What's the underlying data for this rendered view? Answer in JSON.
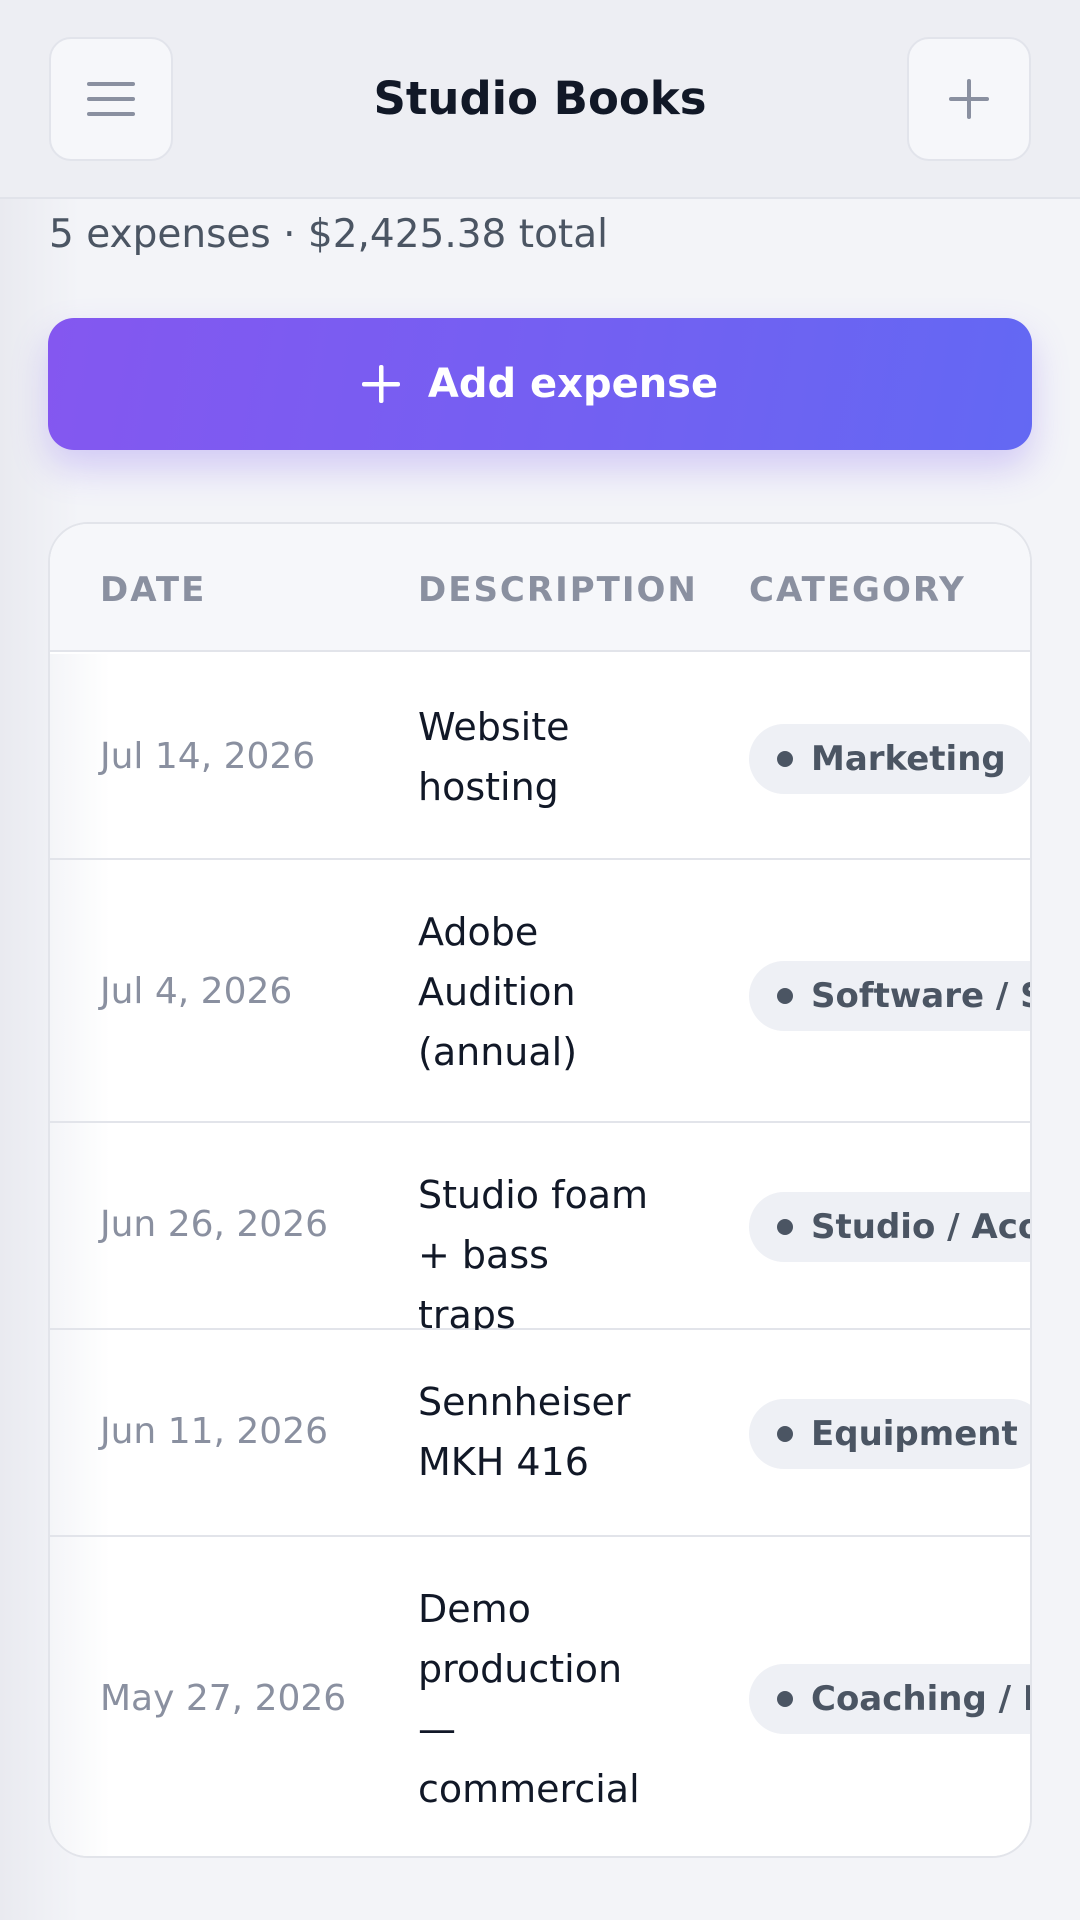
{
  "header": {
    "title": "Studio Books",
    "menu_icon": "hamburger-menu-icon",
    "add_icon": "plus-icon"
  },
  "summary": "5 expenses · $2,425.38 total",
  "add_button": {
    "label": "Add expense",
    "icon": "plus-icon"
  },
  "table": {
    "columns": [
      "DATE",
      "DESCRIPTION",
      "CATEGORY"
    ],
    "rows": [
      {
        "date": "Jul 14, 2026",
        "description": [
          "Website",
          "hosting"
        ],
        "category": "Marketing"
      },
      {
        "date": "Jul 4, 2026",
        "description": [
          "Adobe",
          "Audition",
          "(annual)"
        ],
        "category": "Software / Subscriptions"
      },
      {
        "date": "Jun 26, 2026",
        "description": [
          "Studio foam",
          "+ bass traps"
        ],
        "category": "Studio / Acoustics"
      },
      {
        "date": "Jun 11, 2026",
        "description": [
          "Sennheiser",
          "MKH 416"
        ],
        "category": "Equipment"
      },
      {
        "date": "May 27, 2026",
        "description": [
          "Demo",
          "production",
          "—",
          "commercial"
        ],
        "category": "Coaching / Demo"
      }
    ]
  },
  "colors": {
    "accent_start": "#8457f0",
    "accent_end": "#6368f3",
    "text_primary": "#111827",
    "text_muted": "#8a90a0",
    "pill_bg": "#eef0f5"
  }
}
